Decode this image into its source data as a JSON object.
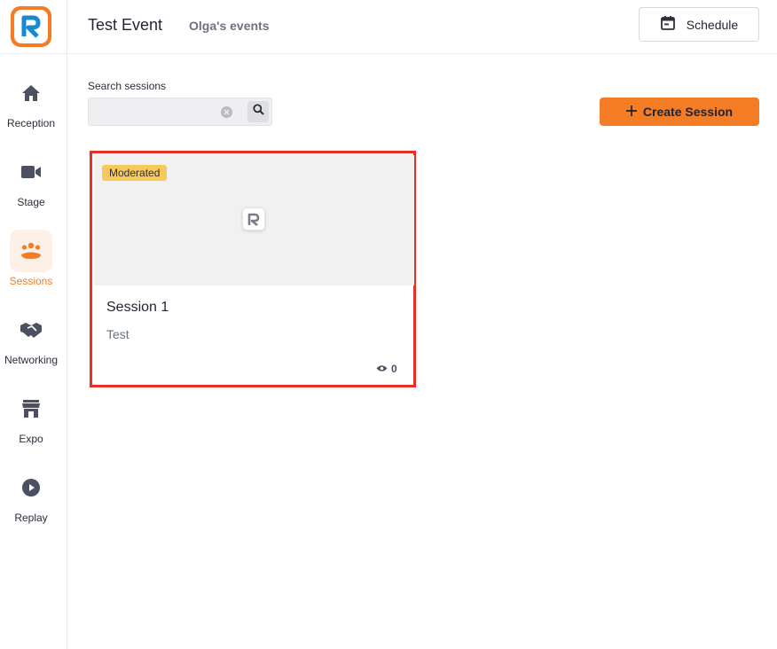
{
  "app": {
    "logo_letter": "R",
    "accent_color": "#f47c25"
  },
  "sidebar": {
    "items": [
      {
        "label": "Reception",
        "icon": "home-icon",
        "active": false
      },
      {
        "label": "Stage",
        "icon": "video-camera-icon",
        "active": false
      },
      {
        "label": "Sessions",
        "icon": "people-group-icon",
        "active": true
      },
      {
        "label": "Networking",
        "icon": "handshake-icon",
        "active": false
      },
      {
        "label": "Expo",
        "icon": "storefront-icon",
        "active": false
      },
      {
        "label": "Replay",
        "icon": "play-circle-icon",
        "active": false
      }
    ]
  },
  "header": {
    "event_title": "Test Event",
    "owner": "Olga's events",
    "schedule_label": "Schedule"
  },
  "search": {
    "label": "Search sessions",
    "value": "",
    "placeholder": ""
  },
  "actions": {
    "create_label": "Create Session"
  },
  "sessions": [
    {
      "badge": "Moderated",
      "title": "Session 1",
      "description": "Test",
      "views": "0"
    }
  ]
}
